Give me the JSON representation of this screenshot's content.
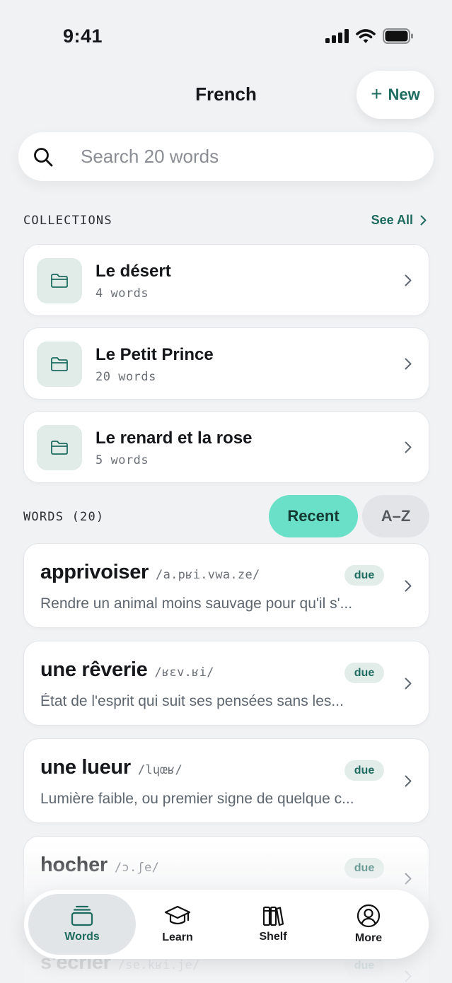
{
  "status": {
    "time": "9:41"
  },
  "header": {
    "title": "French",
    "new_label": "New"
  },
  "search": {
    "placeholder": "Search 20 words"
  },
  "collections": {
    "heading": "COLLECTIONS",
    "see_all": "See All",
    "items": [
      {
        "name": "Le désert",
        "count": "4 words"
      },
      {
        "name": "Le Petit Prince",
        "count": "20 words"
      },
      {
        "name": "Le renard et la rose",
        "count": "5 words"
      }
    ]
  },
  "words": {
    "heading": "WORDS (20)",
    "sort": {
      "recent": "Recent",
      "az": "A–Z",
      "selected": "Recent"
    },
    "items": [
      {
        "term": "apprivoiser",
        "ipa": "/a.pʁi.vwa.ze/",
        "badge": "due",
        "definition": "Rendre un animal moins sauvage pour qu'il s'..."
      },
      {
        "term": "une rêverie",
        "ipa": "/ʁɛv.ʁi/",
        "badge": "due",
        "definition": "État de l'esprit qui suit ses pensées sans les..."
      },
      {
        "term": "une lueur",
        "ipa": "/lɥœʁ/",
        "badge": "due",
        "definition": "Lumière faible, ou premier signe de quelque c..."
      },
      {
        "term": "hocher",
        "ipa": "/ɔ.ʃe/",
        "badge": "due",
        "definition": ""
      },
      {
        "term": "s'écrier",
        "ipa": "/se.kʁi.je/",
        "badge": "due",
        "definition": ""
      }
    ]
  },
  "tabbar": {
    "items": [
      {
        "label": "Words",
        "icon": "stack-icon",
        "active": true
      },
      {
        "label": "Learn",
        "icon": "graduation-cap-icon"
      },
      {
        "label": "Shelf",
        "icon": "books-icon"
      },
      {
        "label": "More",
        "icon": "person-icon"
      }
    ]
  },
  "colors": {
    "accent": "#1e6b5f",
    "segment_active": "#6be0c8",
    "background": "#f1f2f4"
  }
}
